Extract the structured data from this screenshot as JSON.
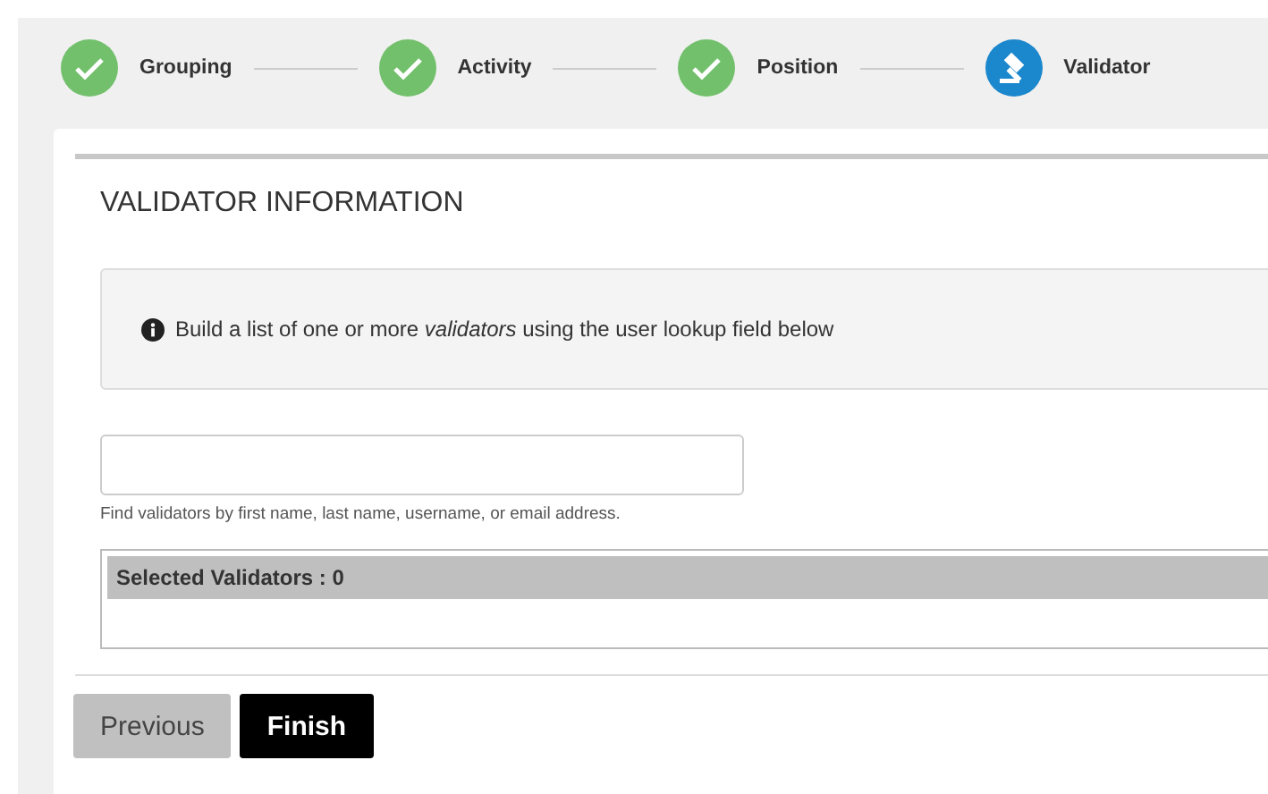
{
  "steps": [
    {
      "label": "Grouping",
      "kind": "complete"
    },
    {
      "label": "Activity",
      "kind": "complete"
    },
    {
      "label": "Position",
      "kind": "complete"
    },
    {
      "label": "Validator",
      "kind": "current"
    }
  ],
  "section": {
    "title": "VALIDATOR INFORMATION",
    "info": "Build a list of one or more *validators* using the user lookup field below",
    "lookup": {
      "help": "Find validators by first name, last name, username, or email address."
    },
    "selected_header": "Selected Validators : 0"
  },
  "buttons": [
    {
      "label": "Previous",
      "kind": "secondary"
    },
    {
      "label": "Finish",
      "kind": "primary"
    }
  ]
}
